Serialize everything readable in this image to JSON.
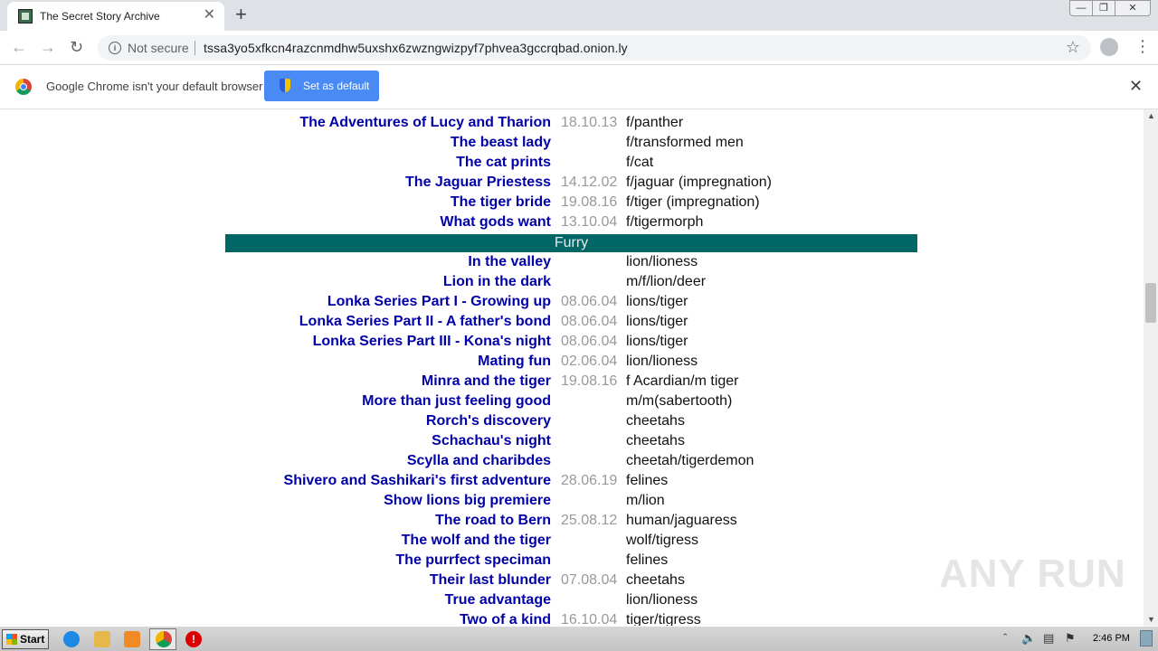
{
  "browser": {
    "tab_title": "The Secret Story Archive",
    "new_tab_glyph": "+",
    "tab_close_glyph": "✕",
    "security_label": "Not secure",
    "url": "tssa3yo5xfkcn4razcnmdhw5uxshx6zwzngwizpyf7phvea3gccrqbad.onion.ly",
    "infobar_message": "Google Chrome isn't your default browser",
    "infobar_button": "Set as default",
    "window_controls": [
      "—",
      "❐",
      "✕"
    ]
  },
  "stories_top": [
    {
      "title": "The Adventures of Lucy and Tharion",
      "date": "18.10.13",
      "kind": "f/panther"
    },
    {
      "title": "The beast lady",
      "date": "",
      "kind": "f/transformed men"
    },
    {
      "title": "The cat prints",
      "date": "",
      "kind": "f/cat"
    },
    {
      "title": "The Jaguar Priestess",
      "date": "14.12.02",
      "kind": "f/jaguar (impregnation)"
    },
    {
      "title": "The tiger bride",
      "date": "19.08.16",
      "kind": "f/tiger (impregnation)"
    },
    {
      "title": "What gods want",
      "date": "13.10.04",
      "kind": "f/tigermorph"
    }
  ],
  "section_title": "Furry",
  "stories_furry": [
    {
      "title": "In the valley",
      "date": "",
      "kind": "lion/lioness"
    },
    {
      "title": "Lion in the dark",
      "date": "",
      "kind": "m/f/lion/deer"
    },
    {
      "title": "Lonka Series Part I - Growing up",
      "date": "08.06.04",
      "kind": "lions/tiger"
    },
    {
      "title": "Lonka Series Part II - A father's bond",
      "date": "08.06.04",
      "kind": "lions/tiger"
    },
    {
      "title": "Lonka Series Part III - Kona's night",
      "date": "08.06.04",
      "kind": "lions/tiger"
    },
    {
      "title": "Mating fun",
      "date": "02.06.04",
      "kind": "lion/lioness"
    },
    {
      "title": "Minra and the tiger",
      "date": "19.08.16",
      "kind": "f Acardian/m tiger"
    },
    {
      "title": "More than just feeling good",
      "date": "",
      "kind": "m/m(sabertooth)"
    },
    {
      "title": "Rorch's discovery",
      "date": "",
      "kind": "cheetahs"
    },
    {
      "title": "Schachau's night",
      "date": "",
      "kind": "cheetahs"
    },
    {
      "title": "Scylla and charibdes",
      "date": "",
      "kind": "cheetah/tigerdemon"
    },
    {
      "title": "Shivero and Sashikari's first adventure",
      "date": "28.06.19",
      "kind": "felines"
    },
    {
      "title": "Show lions big premiere",
      "date": "",
      "kind": "m/lion"
    },
    {
      "title": "The road to Bern",
      "date": "25.08.12",
      "kind": "human/jaguaress"
    },
    {
      "title": "The wolf and the tiger",
      "date": "",
      "kind": "wolf/tigress"
    },
    {
      "title": "The purrfect speciman",
      "date": "",
      "kind": "felines"
    },
    {
      "title": "Their last blunder",
      "date": "07.08.04",
      "kind": "cheetahs"
    },
    {
      "title": "True advantage",
      "date": "",
      "kind": "lion/lioness"
    },
    {
      "title": "Two of a kind",
      "date": "16.10.04",
      "kind": "tiger/tigress"
    }
  ],
  "watermark": "ANY RUN",
  "taskbar": {
    "start_label": "Start",
    "clock": "2:46 PM"
  }
}
